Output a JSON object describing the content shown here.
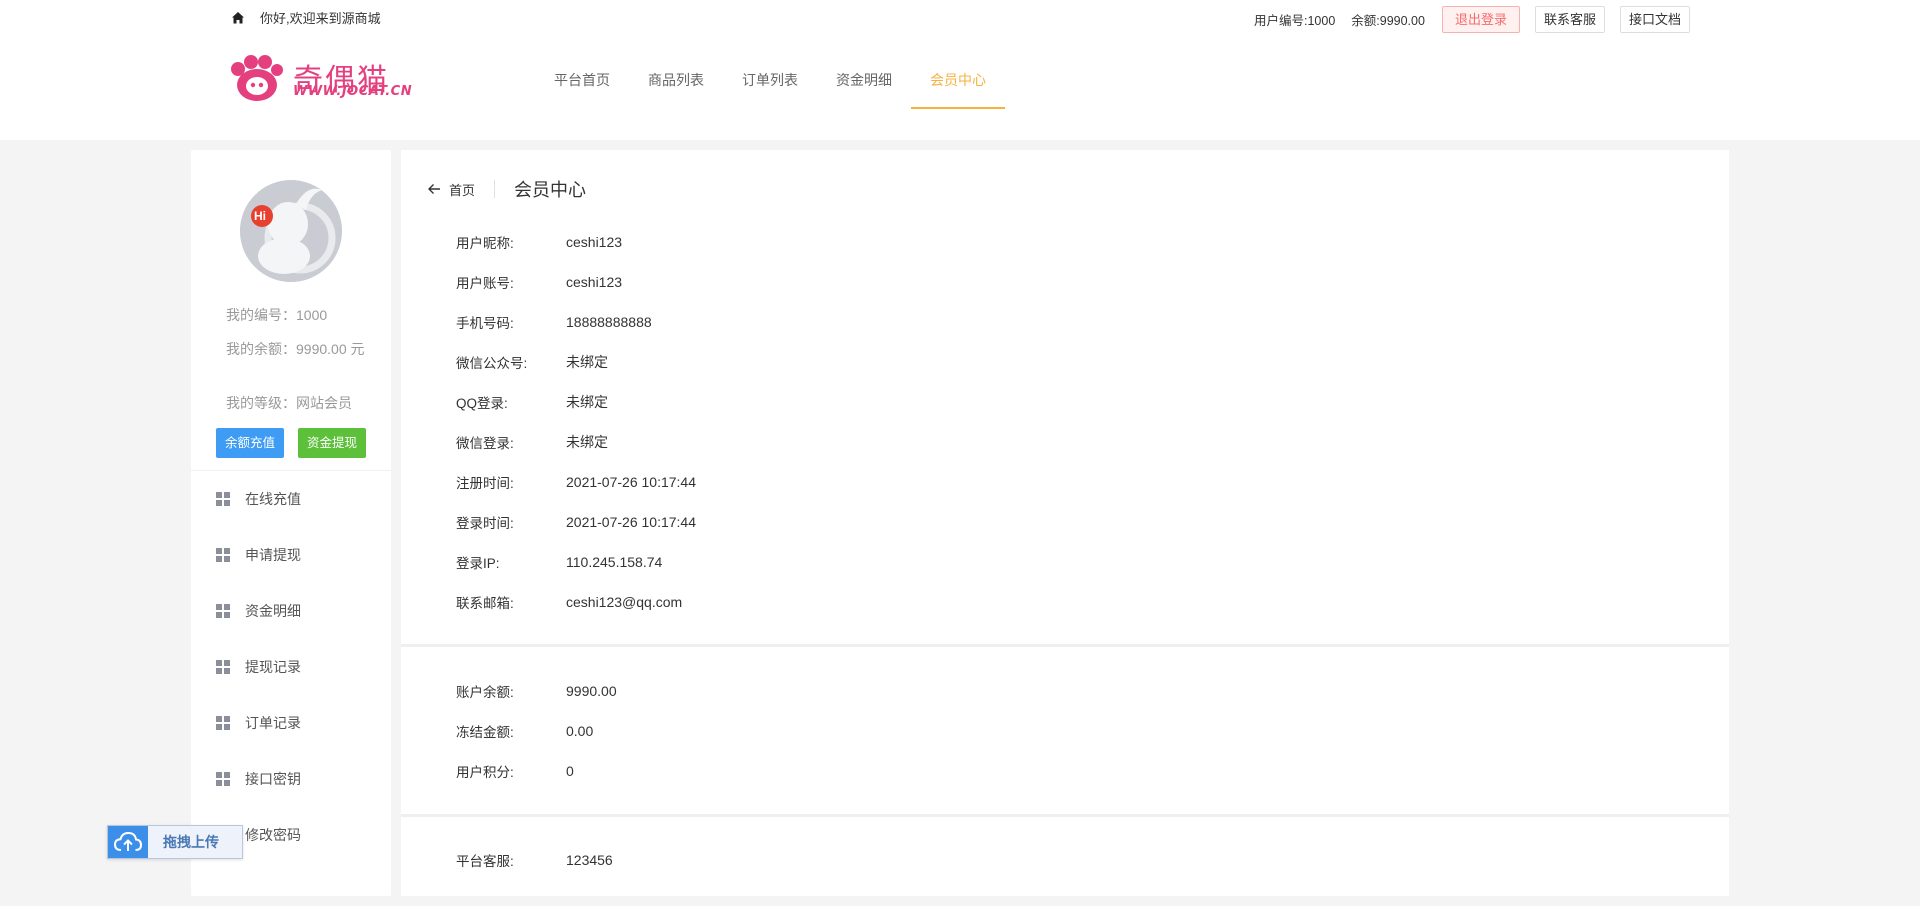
{
  "topbar": {
    "welcome": "你好,欢迎来到源商城",
    "user_id_text": "用户编号:1000",
    "balance_text": "余额:9990.00",
    "logout_label": "退出登录",
    "contact_label": "联系客服",
    "api_doc_label": "接口文档"
  },
  "logo": {
    "text": "奇偶猫",
    "url": "WWW.JOCAT.CN"
  },
  "nav": {
    "items": [
      "平台首页",
      "商品列表",
      "订单列表",
      "资金明细",
      "会员中心"
    ],
    "active": "会员中心"
  },
  "sidebar": {
    "avatar_badge": "Hi",
    "user_no": "我的编号：1000",
    "balance": "我的余额：9990.00 元",
    "level": "我的等级：网站会员",
    "recharge_label": "余额充值",
    "withdraw_label": "资金提现",
    "menu": [
      "在线充值",
      "申请提现",
      "资金明细",
      "提现记录",
      "订单记录",
      "接口密钥",
      "修改密码"
    ]
  },
  "content": {
    "back_label": "首页",
    "title": "会员中心",
    "profile": [
      {
        "label": "用户昵称:",
        "value": "ceshi123"
      },
      {
        "label": "用户账号:",
        "value": "ceshi123"
      },
      {
        "label": "手机号码:",
        "value": "18888888888"
      },
      {
        "label": "微信公众号:",
        "value": "未绑定"
      },
      {
        "label": "QQ登录:",
        "value": "未绑定"
      },
      {
        "label": "微信登录:",
        "value": "未绑定"
      },
      {
        "label": "注册时间:",
        "value": "2021-07-26 10:17:44"
      },
      {
        "label": "登录时间:",
        "value": "2021-07-26 10:17:44"
      },
      {
        "label": "登录IP:",
        "value": "110.245.158.74"
      },
      {
        "label": "联系邮箱:",
        "value": "ceshi123@qq.com"
      }
    ],
    "account": [
      {
        "label": "账户余额:",
        "value": "9990.00"
      },
      {
        "label": "冻结金额:",
        "value": "0.00"
      },
      {
        "label": "用户积分:",
        "value": "0"
      }
    ],
    "service": [
      {
        "label": "平台客服:",
        "value": "123456"
      }
    ]
  },
  "upload_widget": {
    "label": "拖拽上传"
  },
  "colors": {
    "accent": "#f5b23f",
    "recharge": "#3e9cf4",
    "withdraw": "#5cc03a",
    "logout": "#f56c6c",
    "logo": "#e4407f"
  }
}
